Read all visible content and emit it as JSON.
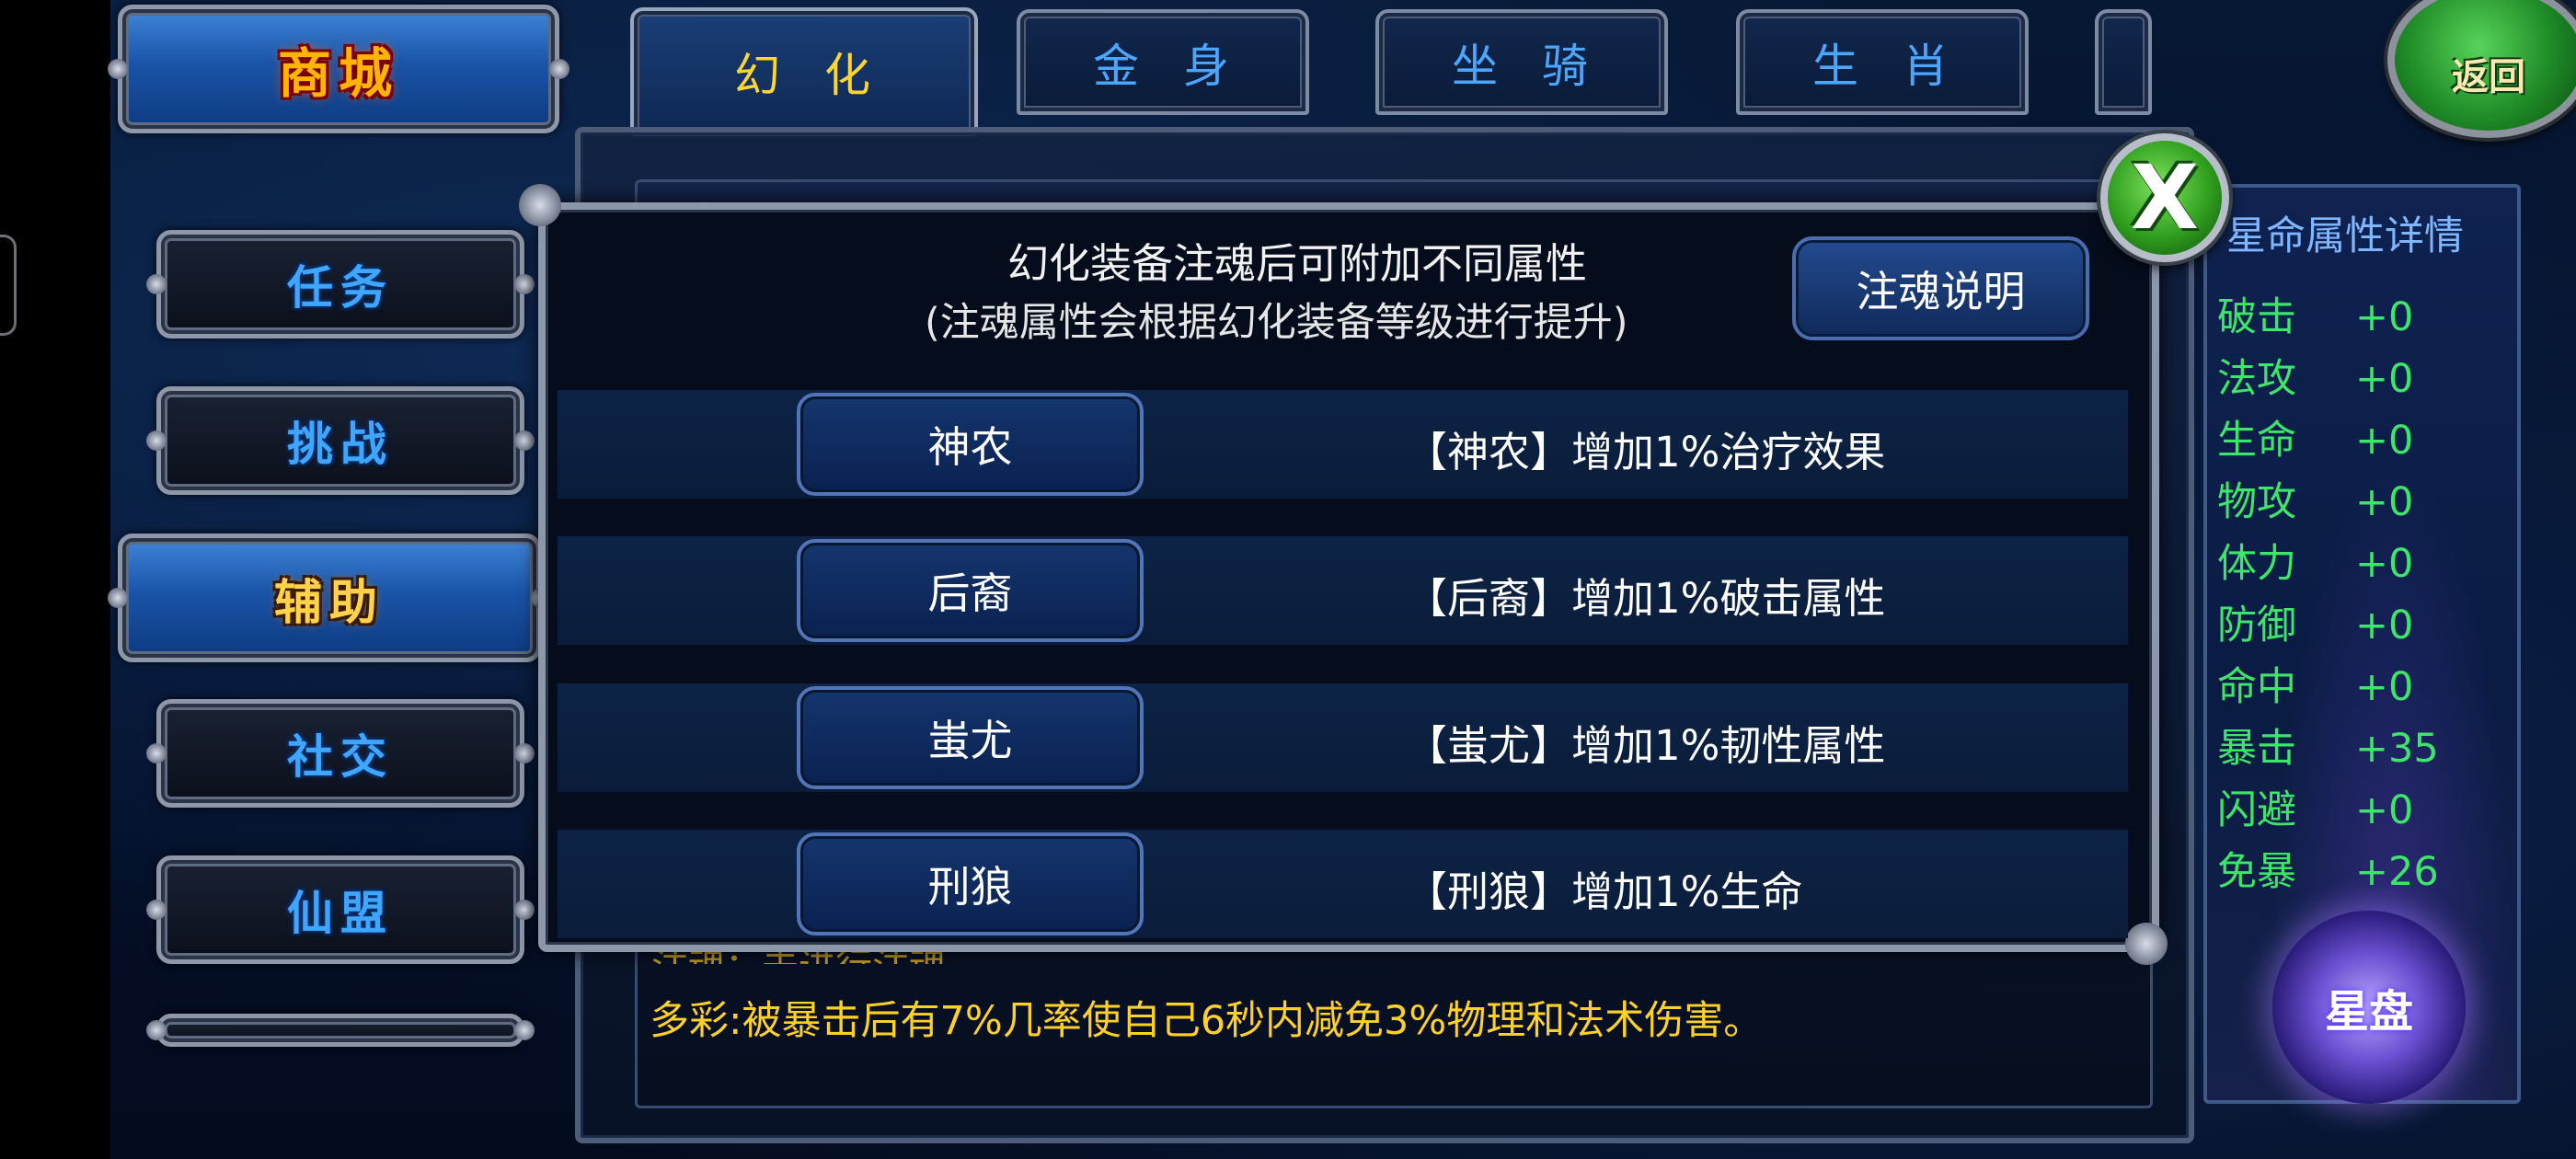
{
  "left_menu": {
    "shop_label": "商城",
    "items": [
      {
        "label": "任务"
      },
      {
        "label": "挑战"
      },
      {
        "label": "辅助"
      },
      {
        "label": "社交"
      },
      {
        "label": "仙盟"
      }
    ],
    "active_item": "辅助"
  },
  "tabs": [
    {
      "label": "幻化",
      "active": true
    },
    {
      "label": "金身",
      "active": false
    },
    {
      "label": "坐骑",
      "active": false
    },
    {
      "label": "生肖",
      "active": false
    }
  ],
  "return_button_label": "返回",
  "attributes_panel": {
    "title": "星命属性详情",
    "items": [
      {
        "name": "破击",
        "value": "+0"
      },
      {
        "name": "法攻",
        "value": "+0"
      },
      {
        "name": "生命",
        "value": "+0"
      },
      {
        "name": "物攻",
        "value": "+0"
      },
      {
        "name": "体力",
        "value": "+0"
      },
      {
        "name": "防御",
        "value": "+0"
      },
      {
        "name": "命中",
        "value": "+0"
      },
      {
        "name": "暴击",
        "value": "+35"
      },
      {
        "name": "闪避",
        "value": "+0"
      },
      {
        "name": "免暴",
        "value": "+26"
      }
    ],
    "star_disc_label": "星盘"
  },
  "underlying": {
    "hint_partial": "注魂：未进行注魂",
    "effect_text": "多彩:被暴击后有7%几率使自己6秒内减免3%物理和法术伤害。"
  },
  "modal": {
    "desc_line1": "幻化装备注魂后可附加不同属性",
    "desc_line2": "(注魂属性会根据幻化装备等级进行提升)",
    "explain_button": "注魂说明",
    "options": [
      {
        "button": "神农",
        "desc": "【神农】增加1%治疗效果"
      },
      {
        "button": "后裔",
        "desc": "【后裔】增加1%破击属性"
      },
      {
        "button": "蚩尤",
        "desc": "【蚩尤】增加1%韧性属性"
      },
      {
        "button": "刑狼",
        "desc": "【刑狼】增加1%生命"
      }
    ],
    "close_icon": "X"
  },
  "colors": {
    "attr_green": "#3de66a",
    "effect_gold": "#ffd128",
    "active_tab_gold": "#ffd531",
    "tab_blue": "#4aa6ff"
  }
}
